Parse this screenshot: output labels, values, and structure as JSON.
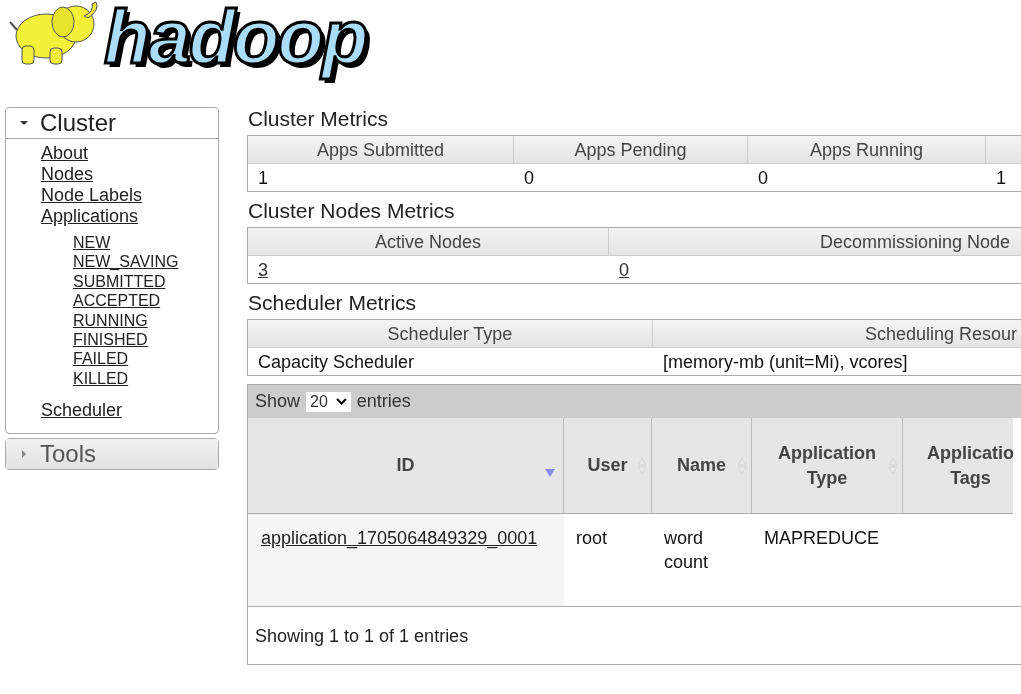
{
  "logo": {
    "text": "hadoop"
  },
  "sidebar": {
    "sections": [
      {
        "title": "Cluster",
        "expanded": true,
        "items": [
          {
            "label": "About"
          },
          {
            "label": "Nodes"
          },
          {
            "label": "Node Labels"
          },
          {
            "label": "Applications",
            "children": [
              {
                "label": "NEW"
              },
              {
                "label": "NEW_SAVING"
              },
              {
                "label": "SUBMITTED"
              },
              {
                "label": "ACCEPTED"
              },
              {
                "label": "RUNNING"
              },
              {
                "label": "FINISHED"
              },
              {
                "label": "FAILED"
              },
              {
                "label": "KILLED"
              }
            ]
          },
          {
            "label": "Scheduler"
          }
        ]
      },
      {
        "title": "Tools",
        "expanded": false
      }
    ]
  },
  "metrics": [
    {
      "title": "Cluster Metrics",
      "columns": [
        {
          "header": "Apps Submitted",
          "value": "1",
          "link": false
        },
        {
          "header": "Apps Pending",
          "value": "0",
          "link": false
        },
        {
          "header": "Apps Running",
          "value": "0",
          "link": false
        },
        {
          "value": "1",
          "link": false
        }
      ]
    },
    {
      "title": "Cluster Nodes Metrics",
      "columns": [
        {
          "header": "Active Nodes",
          "value": "3",
          "link": true
        },
        {
          "header": "Decommissioning Node",
          "value": "0",
          "link": true
        }
      ]
    },
    {
      "title": "Scheduler Metrics",
      "columns": [
        {
          "header": "Scheduler Type",
          "value": "Capacity Scheduler",
          "link": false
        },
        {
          "header": "Scheduling Resour",
          "value": "[memory-mb (unit=Mi), vcores]",
          "link": false
        }
      ]
    }
  ],
  "applications": {
    "show_label": "Show",
    "page_size": "20",
    "entries_label": "entries",
    "columns": [
      {
        "label": "ID",
        "sorted": true
      },
      {
        "label": "User",
        "sorted": false
      },
      {
        "label": "Name",
        "sorted": false
      },
      {
        "label": "Application Type",
        "sorted": false
      },
      {
        "label": "Applicatio Tags"
      }
    ],
    "rows": [
      {
        "cells": [
          "application_1705064849329_0001",
          "root",
          "word count",
          "MAPREDUCE"
        ]
      }
    ],
    "footer": "Showing 1 to 1 of 1 entries"
  }
}
